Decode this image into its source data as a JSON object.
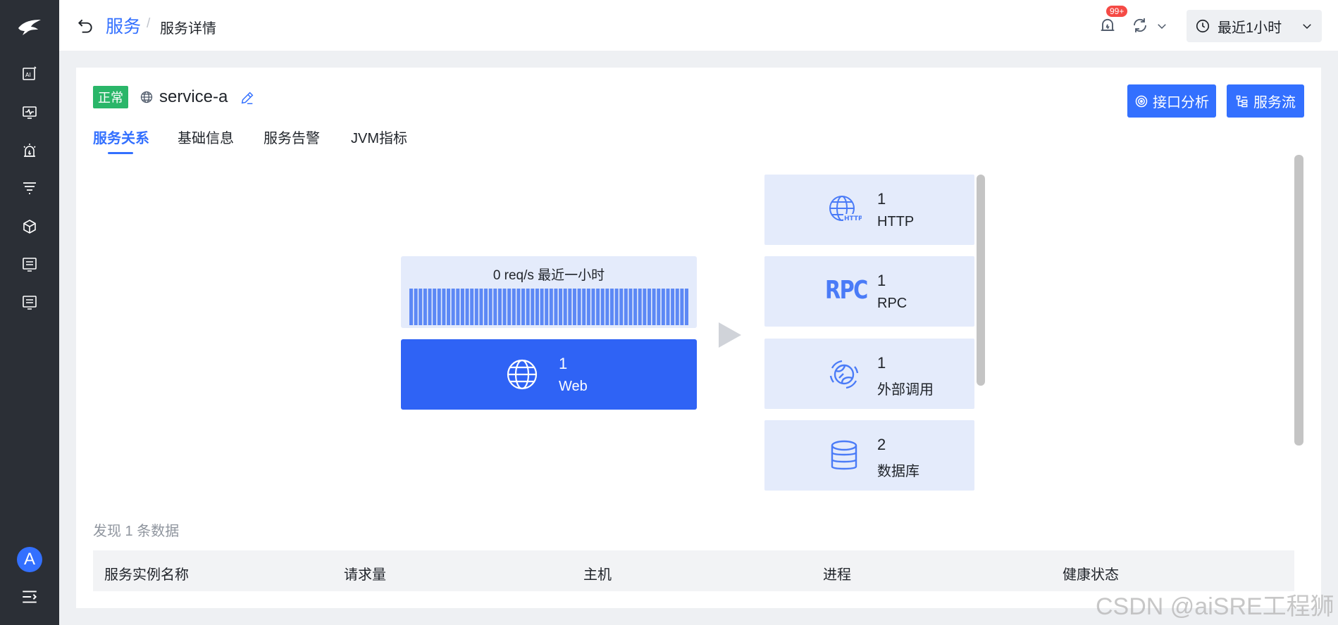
{
  "sidebar": {
    "logo": "brand-logo",
    "items": [
      {
        "icon": "ai-report-icon"
      },
      {
        "icon": "monitor-icon"
      },
      {
        "icon": "alert-siren-icon"
      },
      {
        "icon": "filter-icon"
      },
      {
        "icon": "cube-icon"
      },
      {
        "icon": "list-panel-icon"
      },
      {
        "icon": "list-panel-icon"
      }
    ],
    "avatar": "A"
  },
  "header": {
    "breadcrumb_parent": "服务",
    "breadcrumb_sep": "/",
    "breadcrumb_current": "服务详情",
    "notification_badge": "99+",
    "time_range": "最近1小时"
  },
  "service": {
    "status": "正常",
    "name": "service-a",
    "actions": {
      "interface_analysis": "接口分析",
      "service_flow": "服务流"
    }
  },
  "tabs": [
    {
      "label": "服务关系",
      "active": true
    },
    {
      "label": "基础信息",
      "active": false
    },
    {
      "label": "服务告警",
      "active": false
    },
    {
      "label": "JVM指标",
      "active": false
    }
  ],
  "topology": {
    "traffic_label": "0 req/s  最近一小时",
    "traffic_bar_count": 60,
    "entry": {
      "count": "1",
      "label": "Web"
    },
    "dependencies": [
      {
        "count": "1",
        "label": "HTTP",
        "icon": "http-globe-icon"
      },
      {
        "count": "1",
        "label": "RPC",
        "icon_text": "RPC"
      },
      {
        "count": "1",
        "label": "外部调用",
        "icon": "external-call-icon"
      },
      {
        "count": "2",
        "label": "数据库",
        "icon": "database-icon"
      }
    ]
  },
  "instances": {
    "found_text": "发现 1 条数据",
    "columns": [
      "服务实例名称",
      "请求量",
      "主机",
      "进程",
      "健康状态"
    ]
  },
  "watermark": "CSDN @aiSRE工程狮",
  "colors": {
    "primary": "#3370ff",
    "sidebar": "#2b2f36",
    "status_ok": "#2ab669",
    "panel_bg": "#e4ebfb"
  }
}
